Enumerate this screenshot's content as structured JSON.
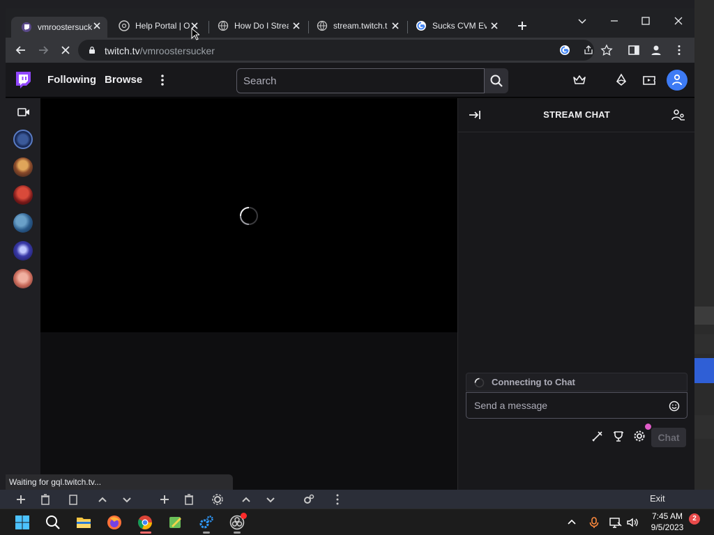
{
  "browser": {
    "tabs": [
      {
        "label": "vmroostersuck",
        "icon": "twitch-favicon",
        "active": true
      },
      {
        "label": "Help Portal | O",
        "icon": "obs-favicon",
        "active": false
      },
      {
        "label": "How Do I Strea",
        "icon": "globe-icon",
        "active": false
      },
      {
        "label": "stream.twitch.t",
        "icon": "globe-icon",
        "active": false
      },
      {
        "label": "Sucks CVM Eve",
        "icon": "google-icon",
        "active": false
      }
    ],
    "url_host": "twitch.tv",
    "url_path": "/vmroostersucker",
    "status_text": "Waiting for gql.twitch.tv..."
  },
  "twitch": {
    "nav": {
      "following": "Following",
      "browse": "Browse"
    },
    "search": {
      "placeholder": "Search"
    },
    "chat": {
      "title": "STREAM CHAT",
      "connecting": "Connecting to Chat",
      "message_placeholder": "Send a message",
      "chat_button": "Chat"
    },
    "sidebar_channels": 6
  },
  "obs": {
    "exit_label": "Exit"
  },
  "taskbar": {
    "time": "7:45 AM",
    "date": "9/5/2023",
    "notifications": "2"
  },
  "colors": {
    "twitch_purple": "#9147ff",
    "twitch_bg": "#0e0e10",
    "accent_blue": "#3d7bf5"
  }
}
